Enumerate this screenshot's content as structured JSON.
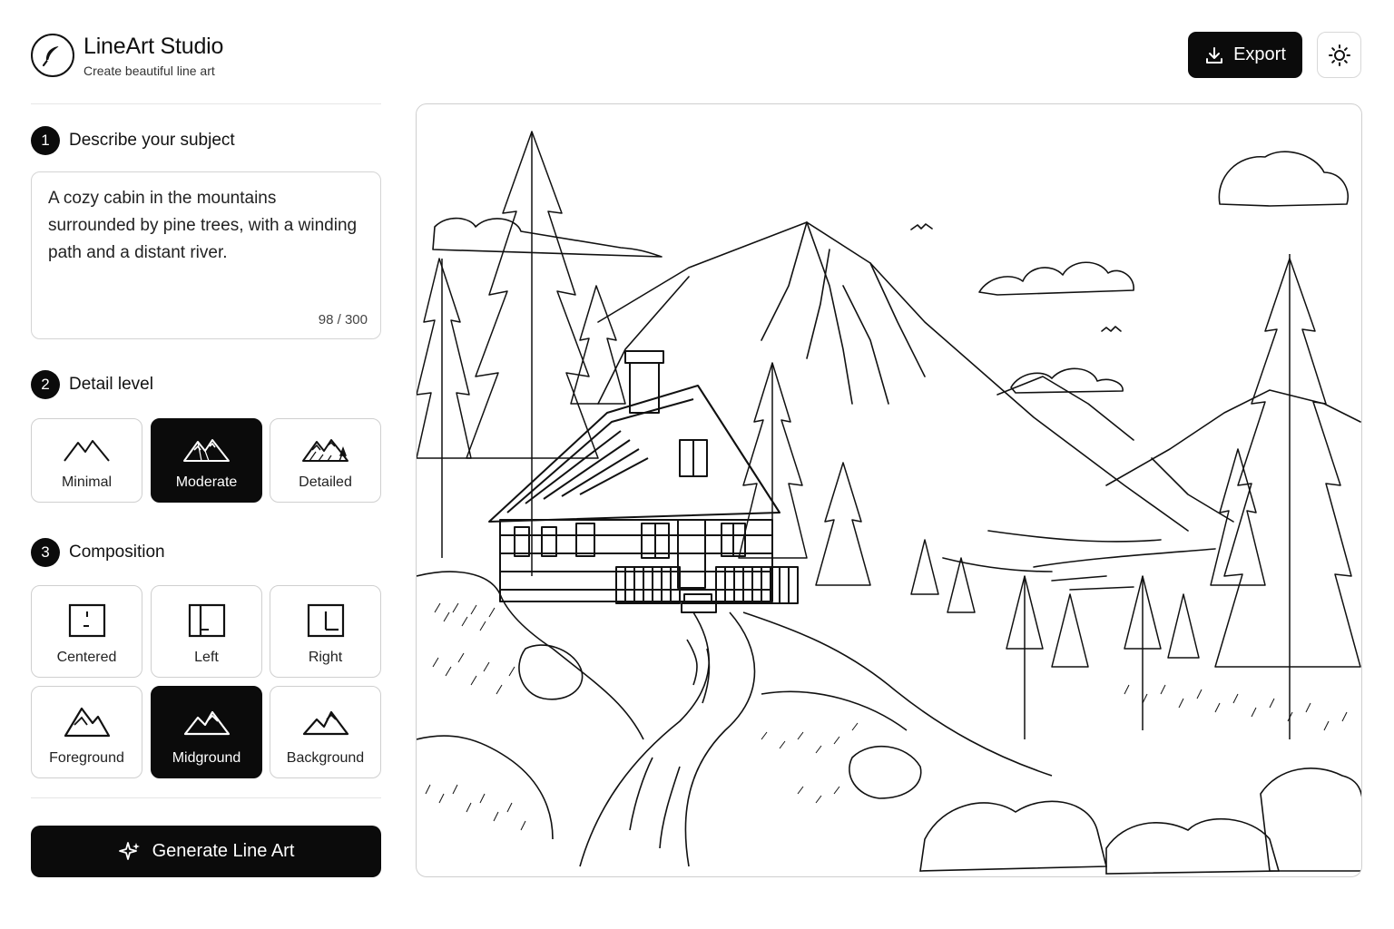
{
  "app": {
    "title": "LineArt Studio",
    "subtitle": "Create beautiful line art",
    "logo_icon": "feather-icon"
  },
  "header": {
    "export_label": "Export",
    "export_icon": "download-icon",
    "theme_icon": "sun-icon"
  },
  "steps": {
    "subject": {
      "number": "1",
      "label": "Describe your subject"
    },
    "detail": {
      "number": "2",
      "label": "Detail level"
    },
    "composition": {
      "number": "3",
      "label": "Composition"
    }
  },
  "prompt": {
    "value": "A cozy cabin in the mountains surrounded by pine trees, with a winding path and a distant river.",
    "char_count": "98 / 300"
  },
  "detail_options": [
    {
      "label": "Minimal",
      "icon": "mountain-minimal-icon",
      "selected": false
    },
    {
      "label": "Moderate",
      "icon": "mountain-moderate-icon",
      "selected": true
    },
    {
      "label": "Detailed",
      "icon": "mountain-detailed-icon",
      "selected": false
    }
  ],
  "composition_options": [
    {
      "label": "Centered",
      "icon": "layout-centered-icon",
      "selected": false
    },
    {
      "label": "Left",
      "icon": "layout-left-icon",
      "selected": false
    },
    {
      "label": "Right",
      "icon": "layout-right-icon",
      "selected": false
    },
    {
      "label": "Foreground",
      "icon": "mountain-foreground-icon",
      "selected": false
    },
    {
      "label": "Midground",
      "icon": "mountain-midground-icon",
      "selected": true
    },
    {
      "label": "Background",
      "icon": "mountain-background-icon",
      "selected": false
    }
  ],
  "generate": {
    "label": "Generate Line Art",
    "icon": "sparkles-icon"
  },
  "colors": {
    "primary": "#0b0b0b",
    "border": "#cfcfcf",
    "background": "#ffffff"
  }
}
